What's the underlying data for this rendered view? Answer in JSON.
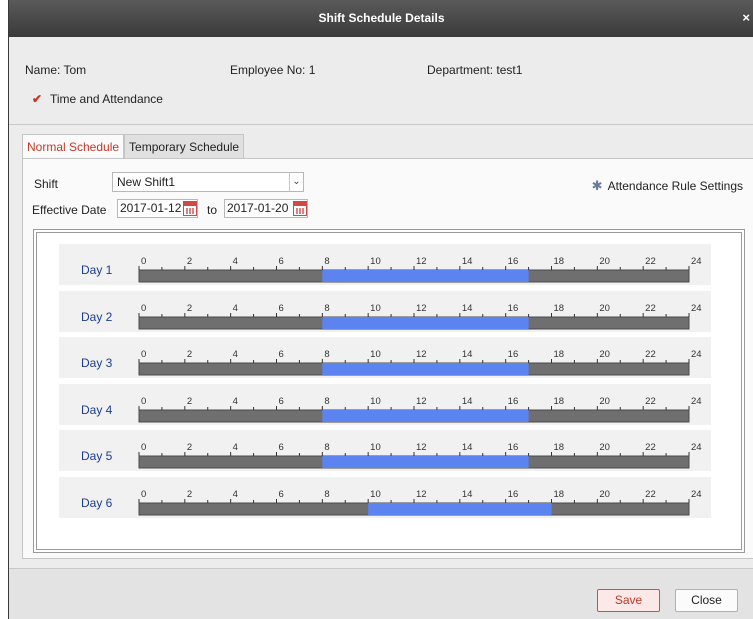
{
  "window": {
    "title": "Shift Schedule Details",
    "close_glyph": "×"
  },
  "employee": {
    "name": "Name: Tom",
    "employee_no": "Employee No: 1",
    "department": "Department: test1",
    "time_attendance_label": "Time and Attendance",
    "time_attendance_checked": true,
    "check_glyph": "✔"
  },
  "tabs": [
    {
      "label": "Normal Schedule",
      "active": true
    },
    {
      "label": "Temporary Schedule",
      "active": false
    }
  ],
  "form": {
    "shift_label": "Shift",
    "shift_value": "New Shift1",
    "dropdown_glyph": "⌄",
    "rule_settings_label": "Attendance Rule Settings",
    "effective_date_label": "Effective Date",
    "date_from": "2017-01-12",
    "to_label": "to",
    "date_to": "2017-01-20"
  },
  "timeline": {
    "hour_labels": [
      "0",
      "2",
      "4",
      "6",
      "8",
      "10",
      "12",
      "14",
      "16",
      "18",
      "20",
      "22",
      "24"
    ],
    "bar_color": "#6f6f6f",
    "active_color": "#5b84f0",
    "days": [
      {
        "label": "Day 1",
        "start": 8,
        "end": 17
      },
      {
        "label": "Day 2",
        "start": 8,
        "end": 17
      },
      {
        "label": "Day 3",
        "start": 8,
        "end": 17
      },
      {
        "label": "Day 4",
        "start": 8,
        "end": 17
      },
      {
        "label": "Day 5",
        "start": 8,
        "end": 17
      },
      {
        "label": "Day 6",
        "start": 10,
        "end": 18
      }
    ]
  },
  "footer": {
    "save_label": "Save",
    "close_label": "Close"
  }
}
